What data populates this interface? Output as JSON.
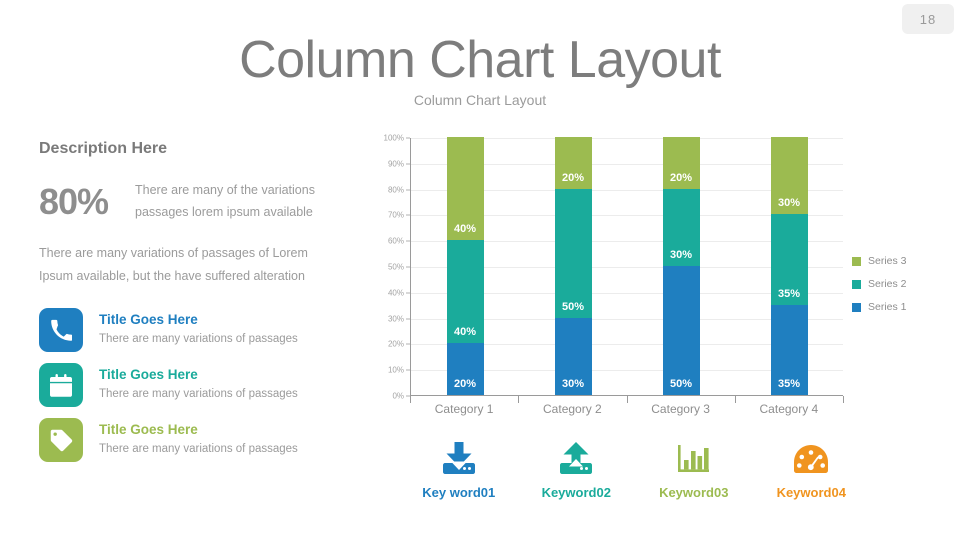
{
  "page_number": "18",
  "header": {
    "title": "Column Chart Layout",
    "subtitle": "Column Chart Layout"
  },
  "left_panel": {
    "heading": "Description Here",
    "stat_value": "80%",
    "stat_text_line1": "There are many of the variations",
    "stat_text_line2": "passages lorem ipsum available",
    "paragraph_line1": "There are many variations of passages  of Lorem",
    "paragraph_line2": "Ipsum available, but the have suffered alteration",
    "features": [
      {
        "icon": "phone-icon",
        "title": "Title Goes Here",
        "subtitle": "There are many variations of passages",
        "color": "#1f7fc0"
      },
      {
        "icon": "calendar-icon",
        "title": "Title Goes Here",
        "subtitle": "There are many variations of passages",
        "color": "#1aab9b"
      },
      {
        "icon": "tag-icon",
        "title": "Title Goes Here",
        "subtitle": "There are many variations of passages",
        "color": "#9cbb50"
      }
    ]
  },
  "chart_data": {
    "type": "bar",
    "stacked": true,
    "title": "",
    "xlabel": "",
    "ylabel": "",
    "ylim": [
      0,
      100
    ],
    "grid": true,
    "legend_position": "right",
    "categories": [
      "Category 1",
      "Category 2",
      "Category 3",
      "Category 4"
    ],
    "y_ticks": [
      "0%",
      "10%",
      "20%",
      "30%",
      "40%",
      "50%",
      "60%",
      "70%",
      "80%",
      "90%",
      "100%"
    ],
    "series": [
      {
        "name": "Series 1",
        "color": "#1f7fc0",
        "values": [
          20,
          30,
          50,
          35
        ],
        "labels": [
          "20%",
          "30%",
          "50%",
          "35%"
        ]
      },
      {
        "name": "Series 2",
        "color": "#1aab9b",
        "values": [
          40,
          50,
          30,
          35
        ],
        "labels": [
          "40%",
          "50%",
          "30%",
          "35%"
        ]
      },
      {
        "name": "Series 3",
        "color": "#9cbb50",
        "values": [
          40,
          20,
          20,
          30
        ],
        "labels": [
          "40%",
          "20%",
          "20%",
          "30%"
        ]
      }
    ],
    "legend_order": [
      "Series 3",
      "Series 2",
      "Series 1"
    ]
  },
  "keywords": [
    {
      "icon": "download-icon",
      "label": "Key word01",
      "color": "#1f7fc0"
    },
    {
      "icon": "upload-icon",
      "label": "Keyword02",
      "color": "#1aab9b"
    },
    {
      "icon": "bar-chart-icon",
      "label": "Keyword03",
      "color": "#9cbb50"
    },
    {
      "icon": "speedometer-icon",
      "label": "Keyword04",
      "color": "#f0941f"
    }
  ]
}
